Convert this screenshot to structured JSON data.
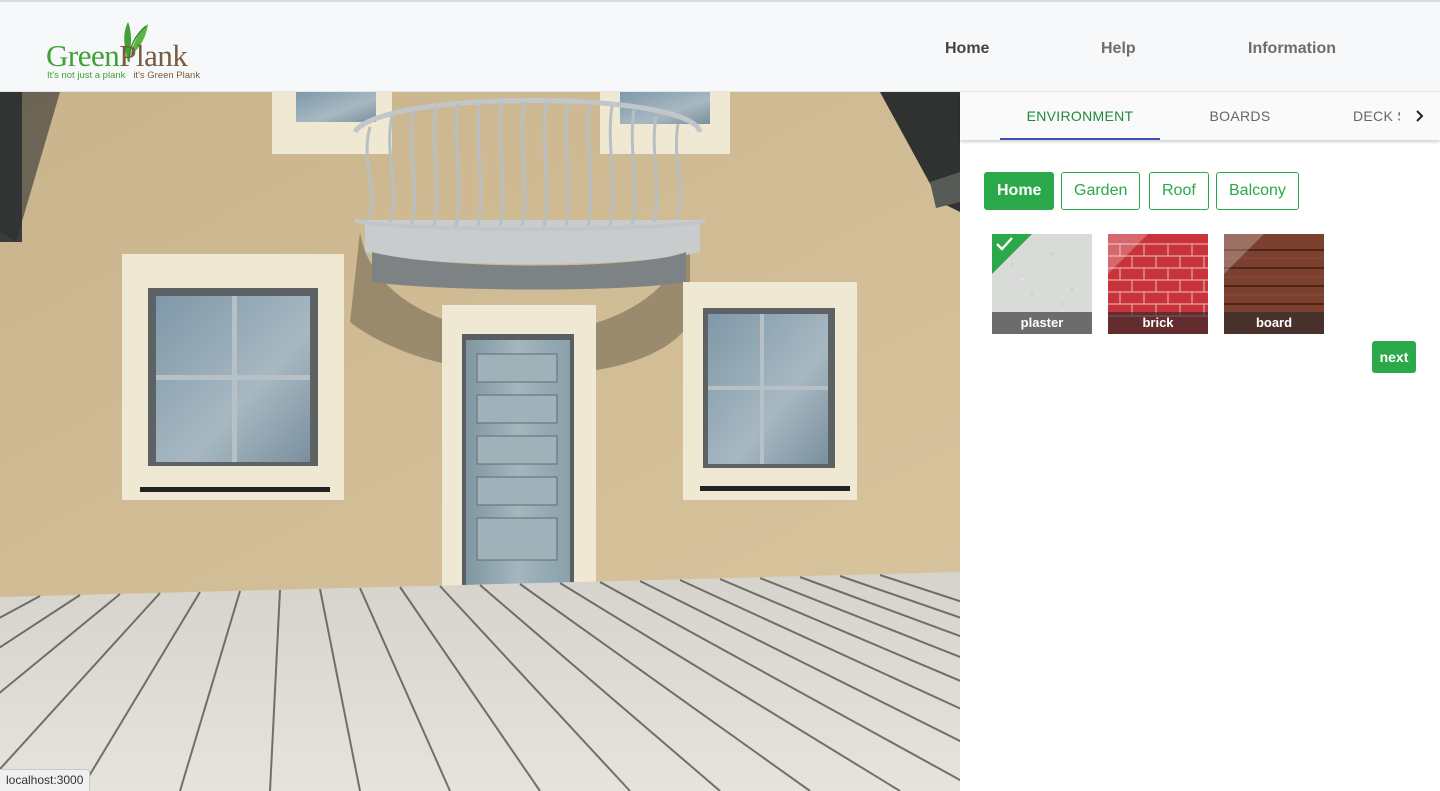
{
  "header": {
    "logo": {
      "brand_green": "Green",
      "brand_brown": "Plank",
      "tagline_1": "It's not just a plank",
      "tagline_2": "it's Green Plank"
    },
    "nav": [
      {
        "label": "Home",
        "active": true
      },
      {
        "label": "Help",
        "active": false
      },
      {
        "label": "Information",
        "active": false
      }
    ]
  },
  "panel": {
    "tabs": [
      {
        "label": "ENVIRONMENT",
        "active": true
      },
      {
        "label": "BOARDS",
        "active": false
      },
      {
        "label": "DECK S",
        "active": false
      }
    ],
    "categories": [
      {
        "label": "Home",
        "active": true
      },
      {
        "label": "Garden",
        "active": false
      },
      {
        "label": "Roof",
        "active": false
      },
      {
        "label": "Balcony",
        "active": false
      }
    ],
    "materials": [
      {
        "label": "plaster",
        "selected": true
      },
      {
        "label": "brick",
        "selected": false
      },
      {
        "label": "board",
        "selected": false
      }
    ],
    "next_label": "next"
  },
  "status_url": "localhost:3000",
  "colors": {
    "accent_green": "#2aa84a",
    "tab_indicator": "#3f51b5",
    "logo_green": "#3fa137",
    "logo_brown": "#7a5c3c"
  }
}
